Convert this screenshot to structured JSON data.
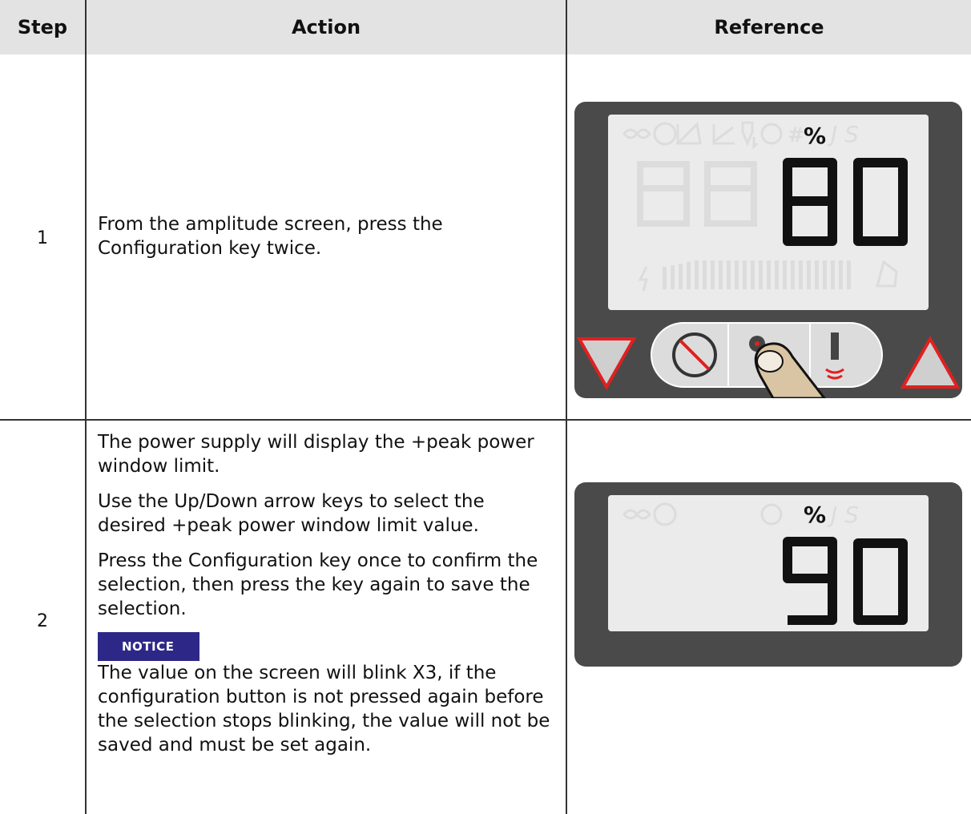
{
  "table": {
    "headers": {
      "step": "Step",
      "action": "Action",
      "reference": "Reference"
    },
    "rows": [
      {
        "step": "1",
        "action": [
          "From the amplitude screen, press the Configuration key twice."
        ],
        "display": {
          "digits": "80",
          "unit": "%",
          "keypad_state": "single-gear, finger pressing configuration key"
        }
      },
      {
        "step": "2",
        "action": [
          "The power supply will display the +peak power window limit.",
          "Use the Up/Down arrow keys to select the desired +peak power window limit value.",
          "Press the Configuration key once to confirm the selection, then press the key again to save the selection."
        ],
        "notice_label": "NOTICE",
        "notice_text": "The value on the screen will blink X3, if the configuration button is not pressed again before the selection stops blinking, the value will not be saved and must be set again.",
        "display": {
          "digits": "90",
          "unit": "%",
          "keypad_state": "double-gear, finger pressing up arrow"
        }
      }
    ]
  },
  "display_icons": [
    "infinity-icon",
    "clock-icon",
    "energy-icon",
    "graph-icon",
    "horn-down-icon",
    "circle-icon",
    "hash-icon"
  ],
  "display_letters": "J S",
  "bar_ticks": [
    "10",
    "20",
    "30",
    "40",
    "50",
    "60",
    "70",
    "80",
    "90",
    "100"
  ],
  "colors": {
    "header_bg": "#e3e3e3",
    "device_bg": "#4a4a4a",
    "lcd_bg": "#ebebeb",
    "notice_bg": "#2d2887",
    "arrow_red": "#e02020",
    "finger": "#d9c4a3"
  }
}
